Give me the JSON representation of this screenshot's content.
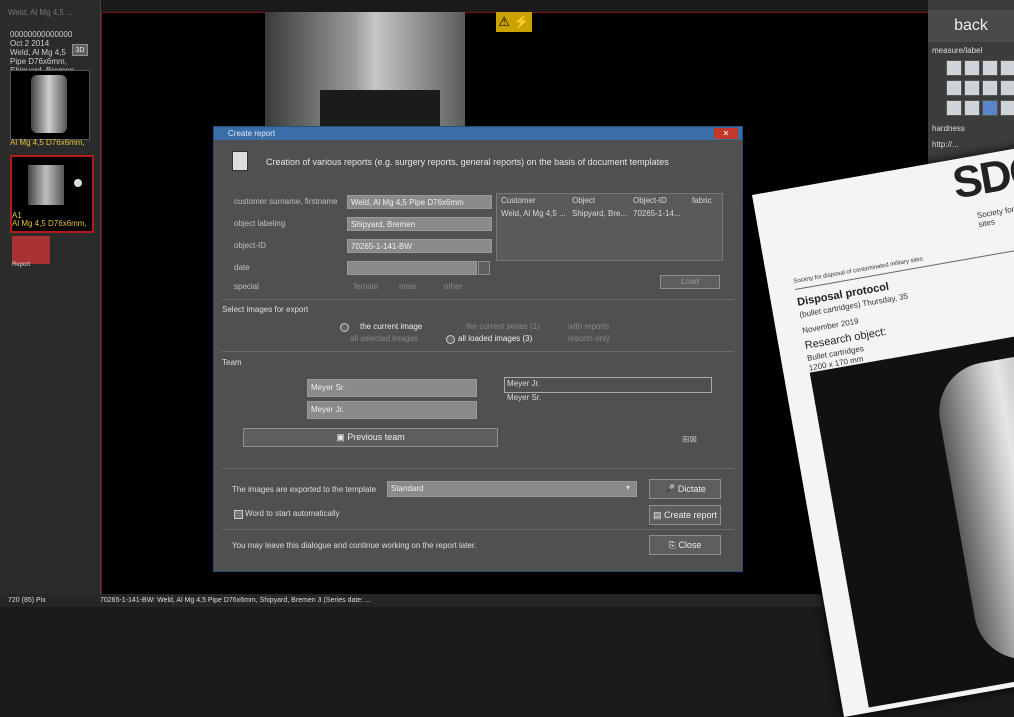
{
  "sidebar": {
    "title": "Weld, Al Mg 4,5 ...",
    "info": "00000000000000\nOct 2 2014\nWeld, Al Mg 4,5\nPipe D76x6mm,\nShipyard, Bremen",
    "dd_label": "3D",
    "thumb1_label": "Al Mg 4,5 D76x6mm,",
    "thumb2_label_a": "A1",
    "thumb2_label_b": "Al Mg 4,5 D76x6mm,",
    "thumb3_label": "Report"
  },
  "warning_glyph": "⚠ ⚡",
  "right_panel": {
    "back_label": "back",
    "measure_label": "measure/label",
    "hr_label": "hardness",
    "http_label": "http://..."
  },
  "dialog": {
    "title": "Create report",
    "close": "✕",
    "header": "Creation of various reports (e.g. surgery reports, general reports) on the basis of document templates",
    "fields": [
      {
        "label": "customer surname, firstname",
        "value": "Weld, Al Mg 4,5 Pipe D76x6mm"
      },
      {
        "label": "object labeling",
        "value": "Shipyard, Bremen"
      },
      {
        "label": "object-ID",
        "value": "70265-1-141-BW"
      },
      {
        "label": "date",
        "value": ""
      }
    ],
    "special_label": "special",
    "special_options": [
      "female",
      "male",
      "other"
    ],
    "table_headers": [
      "Customer",
      "Object",
      "Object-ID",
      "fabric"
    ],
    "table_row": [
      "Weld, Al Mg 4,5 ...",
      "Shipyard, Bre...",
      "70265-1-14...",
      ""
    ],
    "load_label": "Load",
    "select_images_label": "Select images for export",
    "img_opts": [
      "the current image",
      "all selected images",
      "the current series (1)",
      "all loaded images (3)",
      "with reports",
      "reports only"
    ],
    "team_label": "Team",
    "team_fields": [
      "Meyer Sr.",
      "Meyer Jr."
    ],
    "team_list": [
      "Meyer Jr.",
      "Meyer Sr."
    ],
    "prev_team": "Previous team",
    "export_label": "The images are exported to the template",
    "template_value": "Standard",
    "dictate": "Dictate",
    "word_label": "Word to start automatically",
    "create_report": "Create report",
    "leave_label": "You may leave this dialogue and continue working on the report later.",
    "close_label": "Close"
  },
  "status": {
    "left": "720 (85) Pix",
    "text": "70265-1-141-BW: Weld, Al Mg 4,5 Pipe D76x6mm, Shipyard, Bremen 3 (Series date: ..."
  },
  "paper": {
    "logo": "SDCM",
    "org": "Society for disposal of contaminated military sites",
    "small_header": "Society for disposal of contaminated military sites",
    "title": "Disposal protocol",
    "subtitle": "(bullet cartridges) Thursday, 35",
    "date": "November 2019",
    "research": "Research object:",
    "obj1": "Bullet cartridges",
    "obj2": "1200 x 170 mm"
  }
}
